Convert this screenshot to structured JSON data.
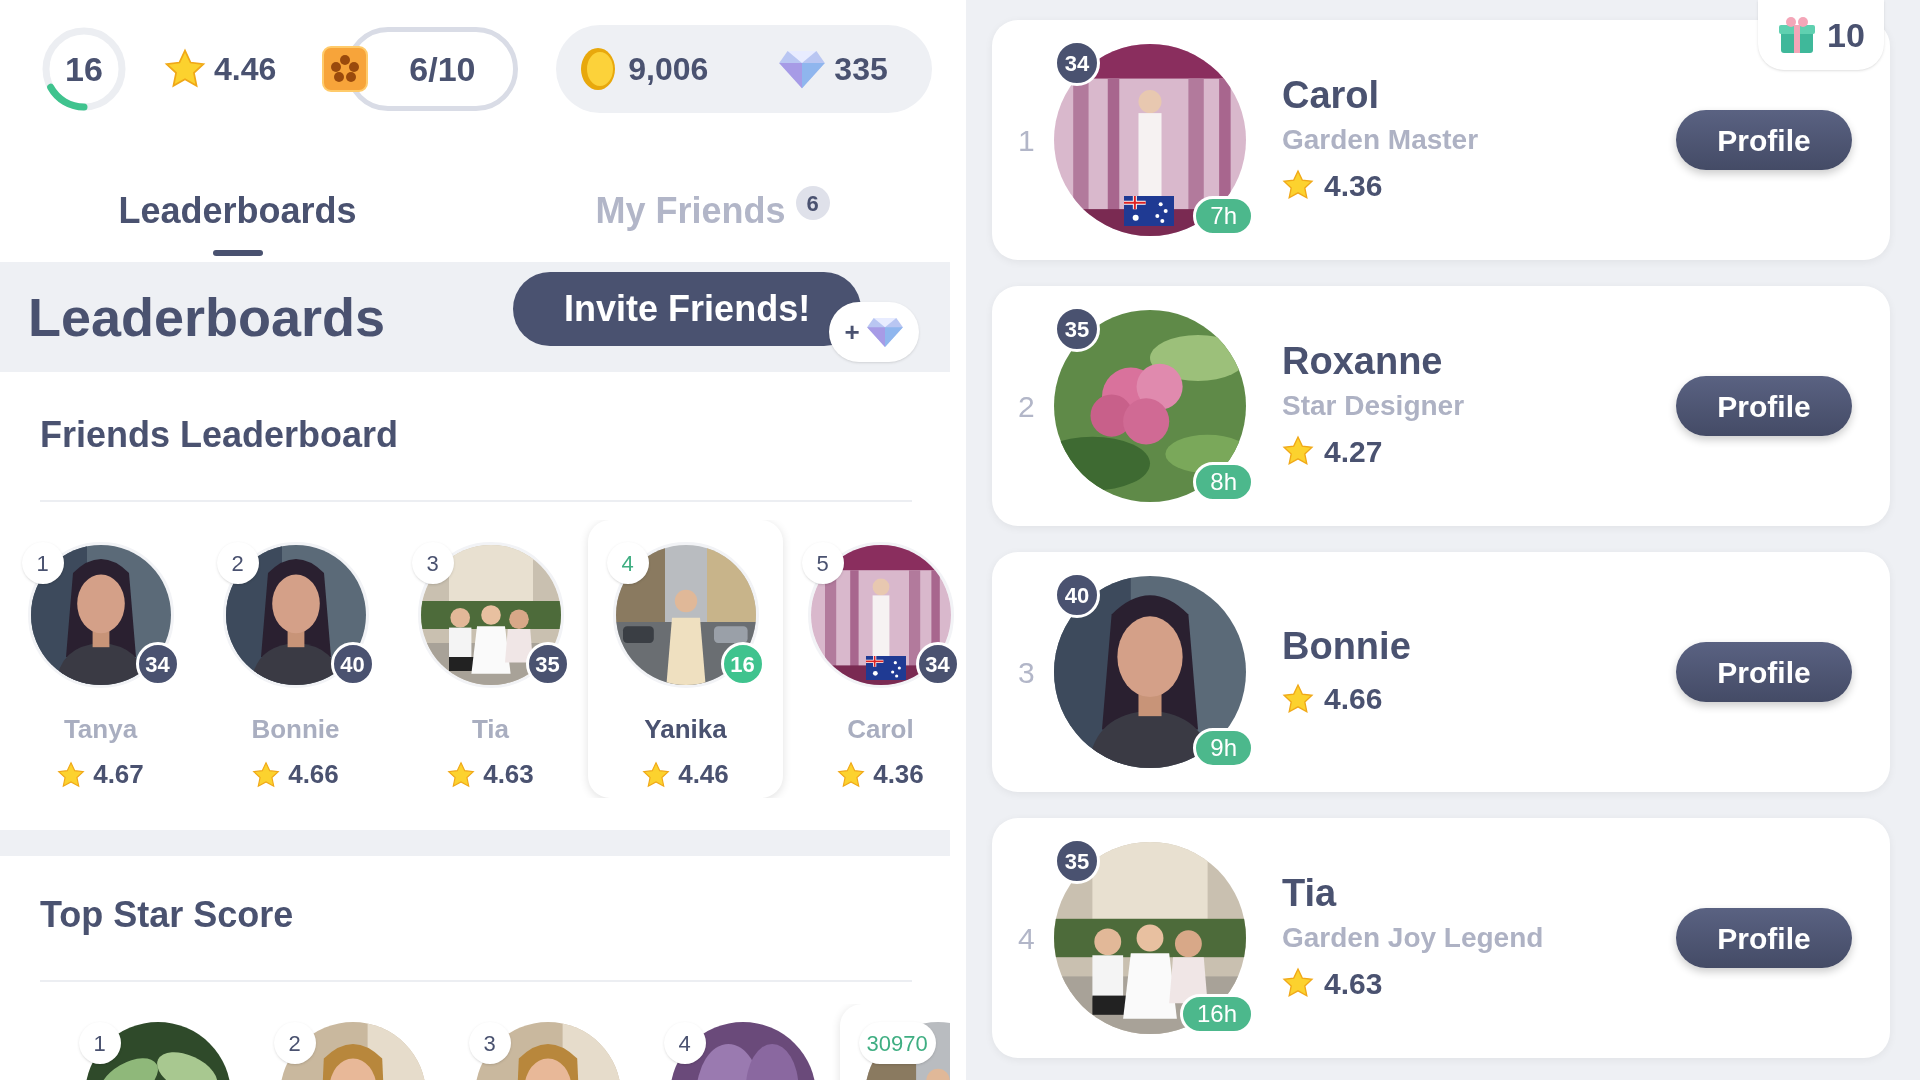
{
  "top_bar": {
    "player_level": {
      "value": "16",
      "level": 0.17
    },
    "rating": "4.46",
    "collection": "6/10",
    "coins": "9,006",
    "gems": "335"
  },
  "tabs": [
    {
      "label": "Leaderboards",
      "selected": true
    },
    {
      "label": "My Friends",
      "badge": "6",
      "selected": false
    }
  ],
  "header": {
    "title": "Leaderboards",
    "invite_button": "Invite Friends!",
    "reward_sign": "+"
  },
  "friends_leaderboard": {
    "title": "Friends Leaderboard",
    "entries": [
      {
        "rank": "1",
        "level_badge": "34",
        "name": "Tanya",
        "rating": "4.67",
        "flag": false,
        "selected": false
      },
      {
        "rank": "2",
        "level_badge": "40",
        "name": "Bonnie",
        "rating": "4.66",
        "flag": false,
        "selected": false
      },
      {
        "rank": "3",
        "level_badge": "35",
        "name": "Tia",
        "rating": "4.63",
        "flag": false,
        "selected": false
      },
      {
        "rank": "4",
        "level_badge": "16",
        "name": "Yanika",
        "rating": "4.46",
        "flag": false,
        "selected": true
      },
      {
        "rank": "5",
        "level_badge": "34",
        "name": "Carol",
        "rating": "4.36",
        "flag": true,
        "selected": false
      }
    ]
  },
  "top_star_score": {
    "title": "Top Star Score",
    "entries": [
      {
        "badge": "1",
        "selected": false
      },
      {
        "badge": "2",
        "selected": false
      },
      {
        "badge": "3",
        "selected": false
      },
      {
        "badge": "4",
        "selected": false
      },
      {
        "badge": "30970",
        "selected": true
      }
    ]
  },
  "gift": {
    "count": "10"
  },
  "friend_cards": [
    {
      "rank": "1",
      "level_badge": "34",
      "time": "7h",
      "name": "Carol",
      "title": "Garden Master",
      "rating": "4.36",
      "flag": true,
      "button": "Profile"
    },
    {
      "rank": "2",
      "level_badge": "35",
      "time": "8h",
      "name": "Roxanne",
      "title": "Star Designer",
      "rating": "4.27",
      "flag": false,
      "button": "Profile"
    },
    {
      "rank": "3",
      "level_badge": "40",
      "time": "9h",
      "name": "Bonnie",
      "rating": "4.66",
      "flag": false,
      "button": "Profile"
    },
    {
      "rank": "4",
      "level_badge": "35",
      "time": "16h",
      "name": "Tia",
      "title": "Garden Joy Legend",
      "rating": "4.63",
      "flag": false,
      "button": "Profile"
    }
  ]
}
